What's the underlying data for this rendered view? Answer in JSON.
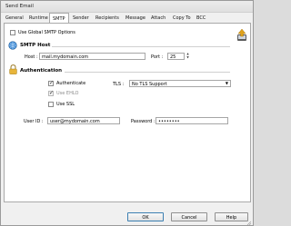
{
  "window": {
    "title": "Send Email"
  },
  "tabs": [
    {
      "label": "General"
    },
    {
      "label": "Runtime"
    },
    {
      "label": "SMTP",
      "active": true
    },
    {
      "label": "Sender"
    },
    {
      "label": "Recipients"
    },
    {
      "label": "Message"
    },
    {
      "label": "Attach"
    },
    {
      "label": "Copy To"
    },
    {
      "label": "BCC"
    }
  ],
  "smtp": {
    "use_global_label": "Use Global SMTP Options",
    "use_global_checked": false,
    "host_section_title": "SMTP Host",
    "host_label": "Host :",
    "host_value": "mail.mydomain.com",
    "port_label": "Port :",
    "port_value": "25",
    "auth_section_title": "Authentication",
    "authenticate_label": "Authenticate",
    "authenticate_checked": true,
    "use_ehlo_label": "Use EHLO",
    "use_ehlo_checked": true,
    "use_ssl_label": "Use SSL",
    "use_ssl_checked": false,
    "tls_label": "TLS :",
    "tls_value": "No TLS Support",
    "user_id_label": "User ID :",
    "user_id_value": "user@mydomain.com",
    "password_label": "Password :",
    "password_value": "••••••••"
  },
  "buttons": {
    "ok": "OK",
    "cancel": "Cancel",
    "help": "Help"
  }
}
